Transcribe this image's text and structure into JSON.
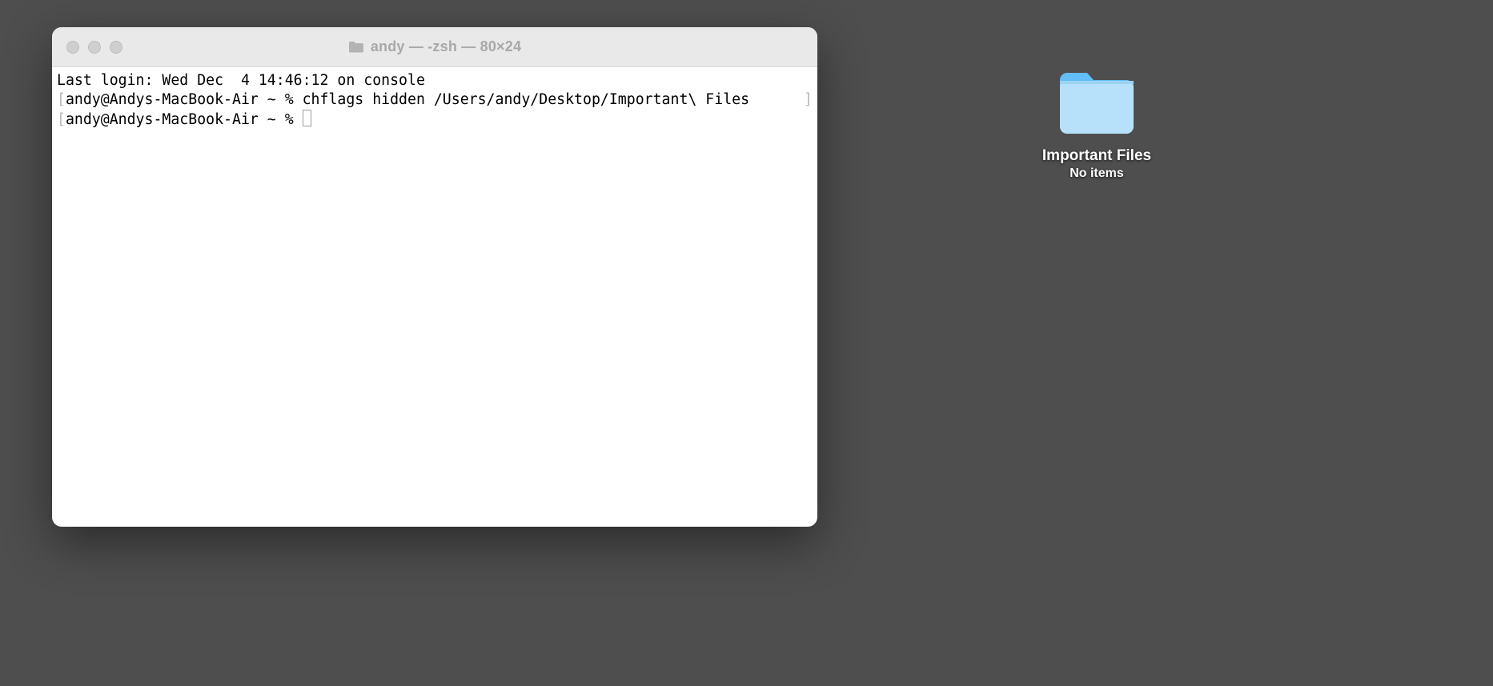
{
  "terminal": {
    "title": "andy — -zsh — 80×24",
    "last_login": "Last login: Wed Dec  4 14:46:12 on console",
    "prompt1": "andy@Andys-MacBook-Air ~ % ",
    "command1": "chflags hidden /Users/andy/Desktop/Important\\ Files ",
    "prompt2": "andy@Andys-MacBook-Air ~ % "
  },
  "desktop": {
    "folder_name": "Important Files",
    "folder_subtitle": "No items"
  }
}
